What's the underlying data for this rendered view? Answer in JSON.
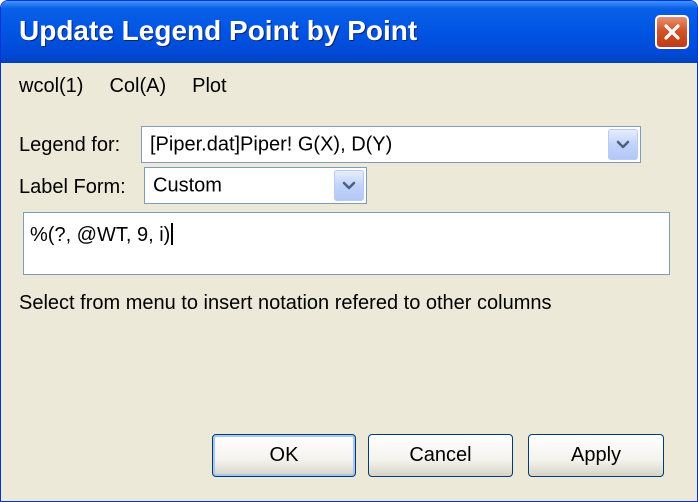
{
  "dialog": {
    "title": "Update Legend Point by Point"
  },
  "menu": {
    "items": [
      "wcol(1)",
      "Col(A)",
      "Plot"
    ]
  },
  "legend_for": {
    "label": "Legend for:",
    "value": "[Piper.dat]Piper! G(X), D(Y)"
  },
  "label_form": {
    "label": "Label Form:",
    "value": "Custom"
  },
  "expression": {
    "value": "%(?, @WT, 9, i)"
  },
  "hint": {
    "text": "Select from menu to insert notation refered to other columns"
  },
  "buttons": {
    "ok": "OK",
    "cancel": "Cancel",
    "apply": "Apply"
  },
  "colors": {
    "titlebar": "#0054e3",
    "dialog_bg": "#ece9d8",
    "close_button": "#d2542b"
  },
  "icons": {
    "close": "close-icon",
    "dropdown": "chevron-down-icon"
  }
}
